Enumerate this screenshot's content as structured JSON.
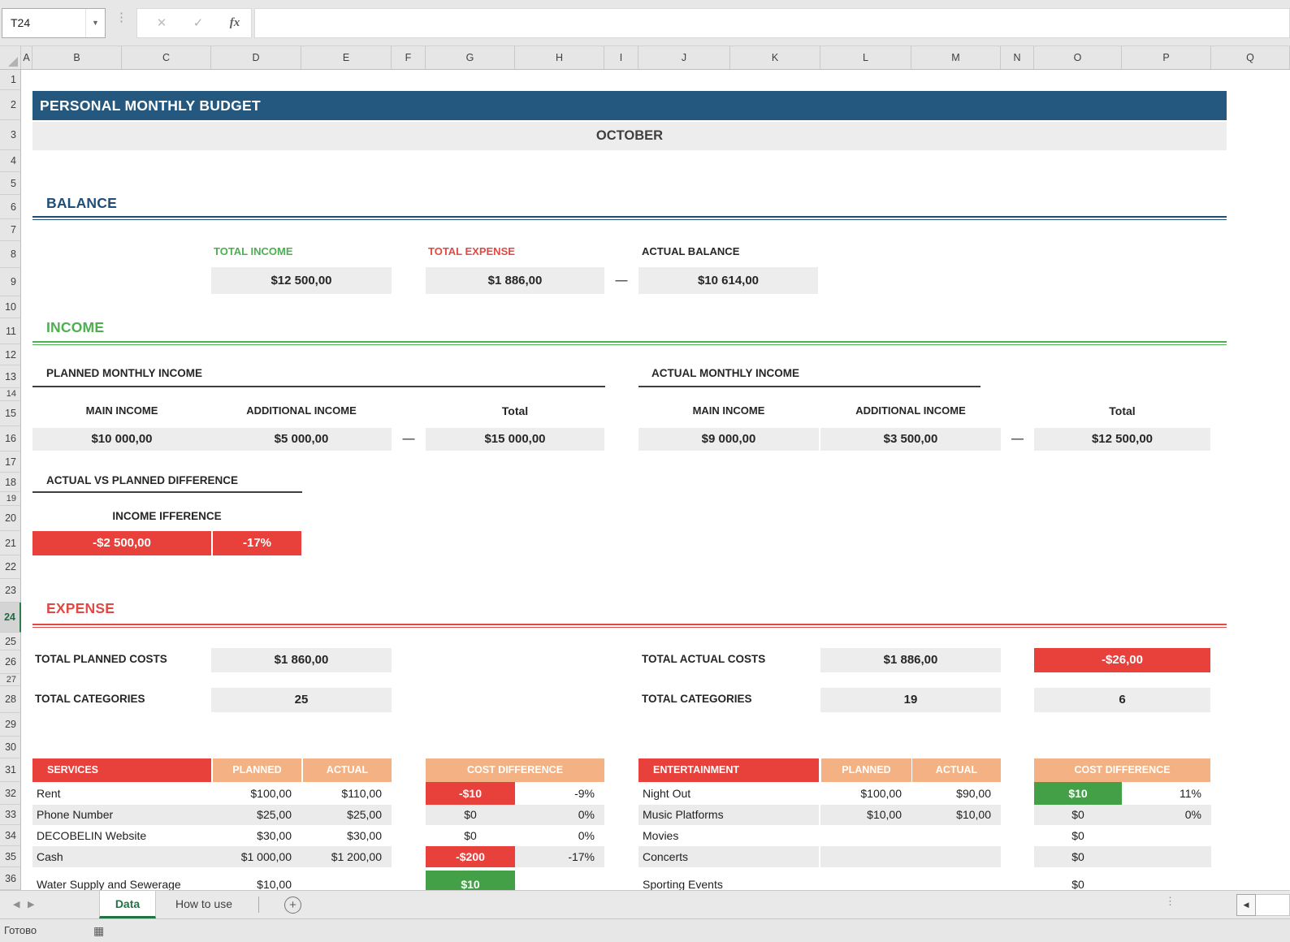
{
  "colors": {
    "title_navy": "#24587F",
    "heading_navy": "#1F4E79",
    "balance_navy": "#203864",
    "green": "#4CAF50",
    "green_cell": "#43A047",
    "tab_green": "#217346",
    "red": "#E04944",
    "red_cell": "#E8413C",
    "salmon": "#F4B183",
    "value_box_gray": "#EDEDED",
    "stripe_gray": "#EBEBEB",
    "chrome_gray": "#E7E7E7"
  },
  "formula_bar": {
    "name_box_value": "T24",
    "cancel_glyph": "✕",
    "confirm_glyph": "✓",
    "function_glyph": "fx",
    "formula_value": ""
  },
  "grid": {
    "columns": [
      "A",
      "B",
      "C",
      "D",
      "E",
      "F",
      "G",
      "H",
      "I",
      "J",
      "K",
      "L",
      "M",
      "N",
      "O",
      "P",
      "Q"
    ],
    "rows": [
      "1",
      "2",
      "3",
      "4",
      "5",
      "6",
      "7",
      "8",
      "9",
      "10",
      "11",
      "12",
      "13",
      "14",
      "15",
      "16",
      "17",
      "18",
      "19",
      "20",
      "21",
      "22",
      "23",
      "24",
      "25",
      "26",
      "27",
      "28",
      "29",
      "30",
      "31",
      "32",
      "33",
      "34",
      "35",
      "36"
    ],
    "active_row": "24"
  },
  "sheet": {
    "title": "PERSONAL MONTHLY BUDGET",
    "month": "OCTOBER",
    "balance": {
      "heading": "BALANCE",
      "income_label": "TOTAL INCOME",
      "income_value": "$12 500,00",
      "expense_label": "TOTAL EXPENSE",
      "expense_value": "$1 886,00",
      "dash": "—",
      "balance_label": "ACTUAL BALANCE",
      "balance_value": "$10 614,00"
    },
    "income": {
      "heading": "INCOME",
      "planned": {
        "heading": "PLANNED MONTHLY INCOME",
        "main_label": "MAIN INCOME",
        "main_value": "$10 000,00",
        "add_label": "ADDITIONAL INCOME",
        "add_value": "$5 000,00",
        "dash": "—",
        "total_label": "Total",
        "total_value": "$15 000,00"
      },
      "actual": {
        "heading": "ACTUAL MONTHLY INCOME",
        "main_label": "MAIN INCOME",
        "main_value": "$9 000,00",
        "add_label": "ADDITIONAL INCOME",
        "add_value": "$3 500,00",
        "dash": "—",
        "total_label": "Total",
        "total_value": "$12 500,00"
      },
      "difference": {
        "heading": "ACTUAL VS PLANNED DIFFERENCE",
        "label": "INCOME IFFERENCE",
        "amount": "-$2 500,00",
        "percent": "-17%"
      }
    },
    "expense": {
      "heading": "EXPENSE",
      "planned_costs_label": "TOTAL PLANNED COSTS",
      "planned_costs": "$1 860,00",
      "planned_categories_label": "TOTAL CATEGORIES",
      "planned_categories": "25",
      "actual_costs_label": "TOTAL ACTUAL COSTS",
      "actual_costs": "$1 886,00",
      "costs_diff": "-$26,00",
      "actual_categories_label": "TOTAL CATEGORIES",
      "actual_categories": "19",
      "categories_diff": "6"
    },
    "tables": [
      {
        "title": "SERVICES",
        "planned": "PLANNED",
        "actual": "ACTUAL",
        "diff": "COST DIFFERENCE",
        "rows": [
          {
            "name": "Rent",
            "planned": "$100,00",
            "actual": "$110,00",
            "diff": "-$10",
            "pct": "-9%"
          },
          {
            "name": "Phone Number",
            "planned": "$25,00",
            "actual": "$25,00",
            "diff": "$0",
            "pct": "0%"
          },
          {
            "name": "DECOBELIN Website",
            "planned": "$30,00",
            "actual": "$30,00",
            "diff": "$0",
            "pct": "0%"
          },
          {
            "name": "Cash",
            "planned": "$1 000,00",
            "actual": "$1 200,00",
            "diff": "-$200",
            "pct": "-17%"
          },
          {
            "name": "Water Supply and Sewerage",
            "planned": "$10,00",
            "actual": "",
            "diff": "$10",
            "pct": ""
          }
        ]
      },
      {
        "title": "ENTERTAINMENT",
        "planned": "PLANNED",
        "actual": "ACTUAL",
        "diff": "COST DIFFERENCE",
        "rows": [
          {
            "name": "Night Out",
            "planned": "$100,00",
            "actual": "$90,00",
            "diff": "$10",
            "pct": "11%"
          },
          {
            "name": "Music Platforms",
            "planned": "$10,00",
            "actual": "$10,00",
            "diff": "$0",
            "pct": "0%"
          },
          {
            "name": "Movies",
            "planned": "",
            "actual": "",
            "diff": "$0",
            "pct": ""
          },
          {
            "name": "Concerts",
            "planned": "",
            "actual": "",
            "diff": "$0",
            "pct": ""
          },
          {
            "name": "Sporting Events",
            "planned": "",
            "actual": "",
            "diff": "$0",
            "pct": ""
          }
        ]
      }
    ]
  },
  "sheet_tabs": {
    "nav_left": "◀",
    "nav_right": "▶",
    "tabs": [
      {
        "label": "Data"
      },
      {
        "label": "How to use"
      }
    ],
    "add_glyph": "+",
    "scroll_left_glyph": "◀"
  },
  "status_bar": {
    "ready": "Готово"
  }
}
